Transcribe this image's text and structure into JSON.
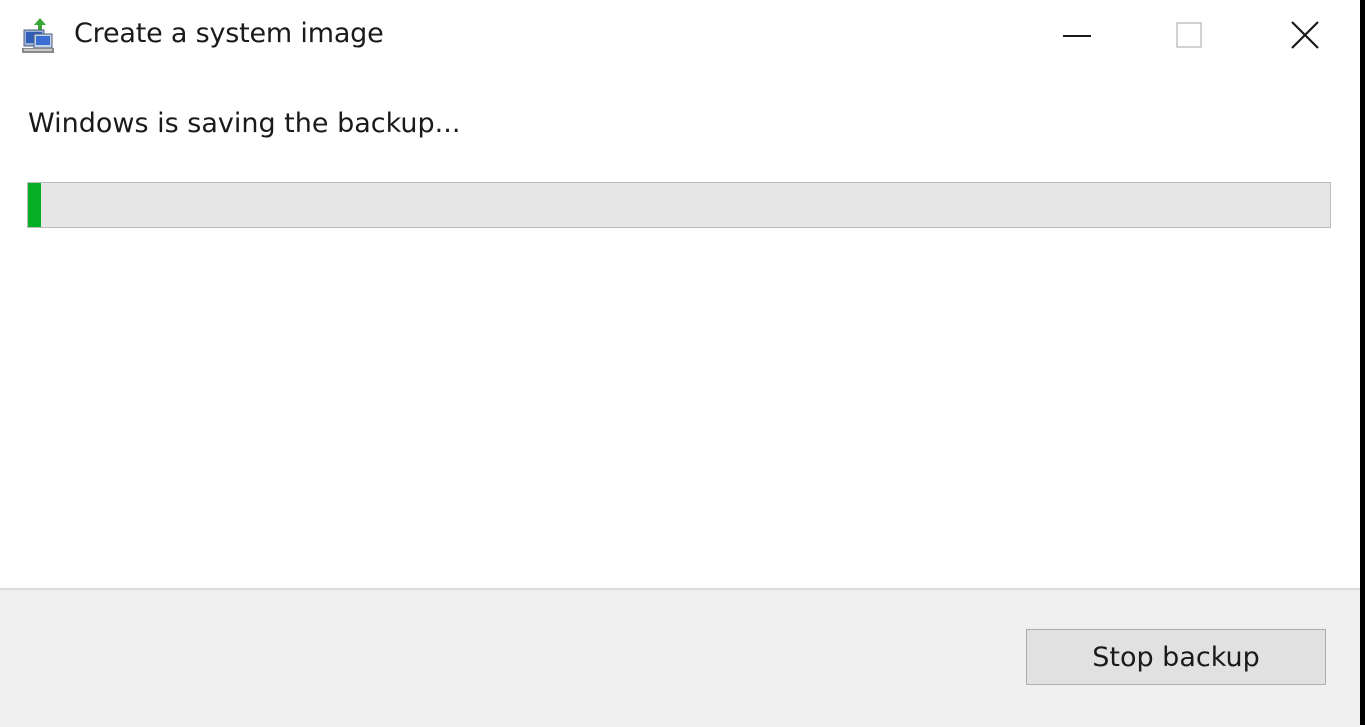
{
  "window": {
    "title": "Create a system image",
    "icon": "backup-computer-icon",
    "controls": {
      "minimize_icon": "minimize-icon",
      "maximize_icon": "maximize-icon",
      "close_icon": "close-icon"
    }
  },
  "main": {
    "status_text": "Windows is saving the backup...",
    "progress_fraction": 0.01,
    "progress_color": "#06b025"
  },
  "footer": {
    "stop_button_label": "Stop backup"
  }
}
